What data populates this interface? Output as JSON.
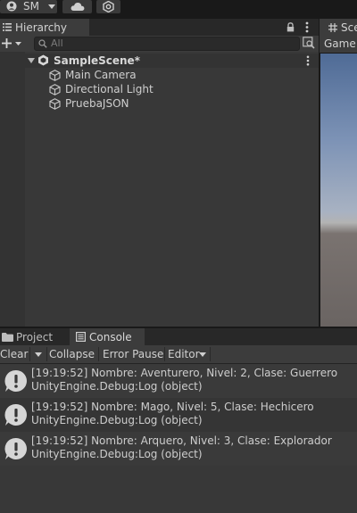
{
  "toolbar": {
    "account_label": "SM"
  },
  "hierarchy": {
    "tab_label": "Hierarchy",
    "search_placeholder": "All",
    "scene_name": "SampleScene*",
    "items": [
      {
        "label": "Main Camera"
      },
      {
        "label": "Directional Light"
      },
      {
        "label": "PruebaJSON"
      }
    ]
  },
  "scene_panel": {
    "tab_label": "Sce",
    "game_label": "Game"
  },
  "bottom_tabs": {
    "project_label": "Project",
    "console_label": "Console"
  },
  "console": {
    "clear_label": "Clear",
    "collapse_label": "Collapse",
    "error_pause_label": "Error Pause",
    "editor_label": "Editor",
    "logs": [
      {
        "line1": "[19:19:52] Nombre: Aventurero, Nivel: 2, Clase: Guerrero",
        "line2": "UnityEngine.Debug:Log (object)"
      },
      {
        "line1": "[19:19:52] Nombre: Mago, Nivel: 5, Clase: Hechicero",
        "line2": "UnityEngine.Debug:Log (object)"
      },
      {
        "line1": "[19:19:52] Nombre: Arquero, Nivel: 3, Clase: Explorador",
        "line2": "UnityEngine.Debug:Log (object)"
      }
    ]
  }
}
